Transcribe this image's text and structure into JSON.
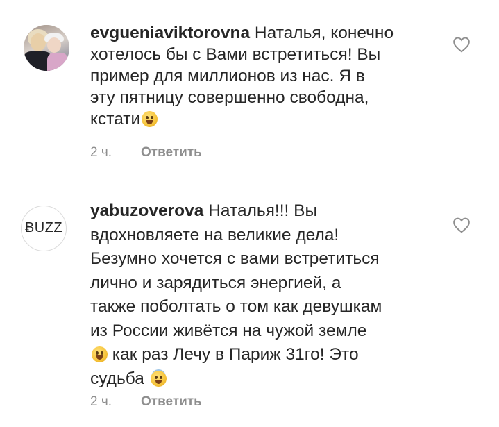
{
  "comments": [
    {
      "username": "evgueniaviktorovna",
      "text_first": " Наталья, конечно",
      "lines": [
        "хотелось бы с Вами встретиться! Вы",
        "пример для миллионов из нас. Я в",
        "эту пятницу совершенно свободна,",
        "кстати"
      ],
      "time": "2 ч.",
      "reply_label": "Ответить",
      "avatar_icon": "user-photo-avatar",
      "like_icon": "heart-outline-icon"
    },
    {
      "username": "yabuzoverova",
      "text_first": " Наталья!!! Вы",
      "lines": [
        "вдохновляете на великие дела!",
        "Безумно хочется с вами встретиться",
        "лично и зарядиться энергией, а",
        "также поболтать о том как девушкам",
        "из России живётся на чужой земле"
      ],
      "line_after_emoji": " как раз Лечу в Париж 31го! Это",
      "last_line": "судьба",
      "avatar_logo_text": "BUZZ",
      "avatar_logo_small": "the",
      "time": "2 ч.",
      "reply_label": "Ответить",
      "like_icon": "heart-outline-icon"
    }
  ],
  "colors": {
    "text": "#262626",
    "meta": "#8e8e8e",
    "background": "#ffffff"
  }
}
